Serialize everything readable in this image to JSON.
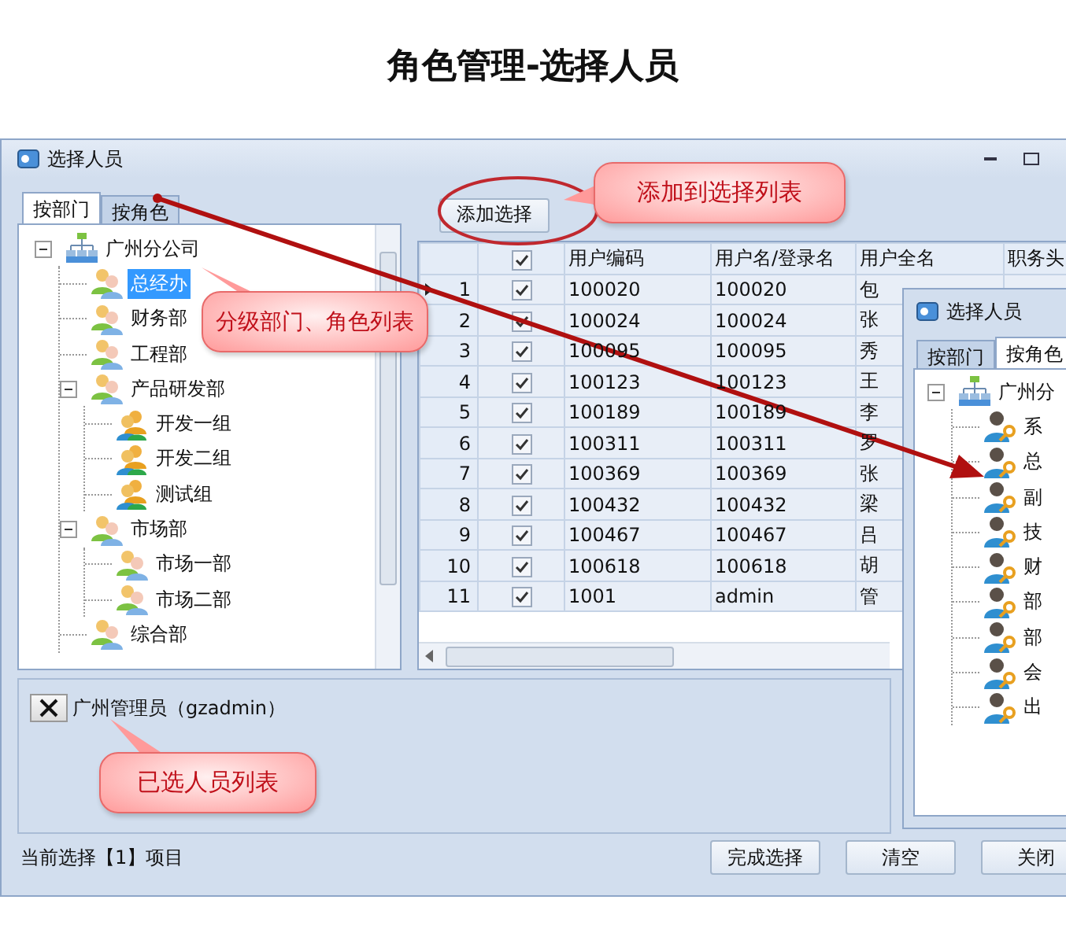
{
  "page_title": "角色管理-选择人员",
  "window": {
    "title": "选择人员"
  },
  "left_tabs": [
    {
      "label": "按部门",
      "selected": true
    },
    {
      "label": "按角色",
      "selected": false
    }
  ],
  "tree": [
    {
      "label": "广州分公司",
      "kind": "org",
      "expanded": true,
      "selected": false,
      "children": [
        {
          "label": "总经办",
          "kind": "dept",
          "selected": true
        },
        {
          "label": "财务部",
          "kind": "dept",
          "selected": false
        },
        {
          "label": "工程部",
          "kind": "dept",
          "selected": false
        },
        {
          "label": "产品研发部",
          "kind": "dept",
          "expanded": true,
          "selected": false,
          "children": [
            {
              "label": "开发一组",
              "kind": "team",
              "selected": false
            },
            {
              "label": "开发二组",
              "kind": "team",
              "selected": false
            },
            {
              "label": "测试组",
              "kind": "team",
              "selected": false
            }
          ]
        },
        {
          "label": "市场部",
          "kind": "dept",
          "expanded": true,
          "selected": false,
          "children": [
            {
              "label": "市场一部",
              "kind": "dept",
              "selected": false
            },
            {
              "label": "市场二部",
              "kind": "dept",
              "selected": false
            }
          ]
        },
        {
          "label": "综合部",
          "kind": "dept",
          "selected": false
        }
      ]
    }
  ],
  "add_button": "添加选择",
  "grid": {
    "columns": [
      "用户编码",
      "用户名/登录名",
      "用户全名",
      "职务头"
    ],
    "header_checked": true,
    "rows": [
      {
        "index": "1",
        "checked": true,
        "current": true,
        "code": "100020",
        "login": "100020",
        "full_name": "包"
      },
      {
        "index": "2",
        "checked": true,
        "current": false,
        "code": "100024",
        "login": "100024",
        "full_name": "张"
      },
      {
        "index": "3",
        "checked": true,
        "current": false,
        "code": "100095",
        "login": "100095",
        "full_name": "秀"
      },
      {
        "index": "4",
        "checked": true,
        "current": false,
        "code": "100123",
        "login": "100123",
        "full_name": "王"
      },
      {
        "index": "5",
        "checked": true,
        "current": false,
        "code": "100189",
        "login": "100189",
        "full_name": "李"
      },
      {
        "index": "6",
        "checked": true,
        "current": false,
        "code": "100311",
        "login": "100311",
        "full_name": "罗"
      },
      {
        "index": "7",
        "checked": true,
        "current": false,
        "code": "100369",
        "login": "100369",
        "full_name": "张"
      },
      {
        "index": "8",
        "checked": true,
        "current": false,
        "code": "100432",
        "login": "100432",
        "full_name": "梁"
      },
      {
        "index": "9",
        "checked": true,
        "current": false,
        "code": "100467",
        "login": "100467",
        "full_name": "吕"
      },
      {
        "index": "10",
        "checked": true,
        "current": false,
        "code": "100618",
        "login": "100618",
        "full_name": "胡"
      },
      {
        "index": "11",
        "checked": true,
        "current": false,
        "code": "1001",
        "login": "admin",
        "full_name": "管"
      }
    ]
  },
  "selected_people": [
    {
      "label": "广州管理员（gzadmin）"
    }
  ],
  "status": "当前选择【1】项目",
  "buttons": [
    "完成选择",
    "清空",
    "关闭"
  ],
  "inset_window": {
    "title": "选择人员",
    "tabs": [
      {
        "label": "按部门",
        "selected": false
      },
      {
        "label": "按角色",
        "selected": true
      }
    ],
    "tree": [
      {
        "label": "广州分",
        "kind": "org",
        "expanded": true,
        "selected": false,
        "children": [
          {
            "label": "系",
            "kind": "role",
            "selected": false
          },
          {
            "label": "总",
            "kind": "role",
            "selected": false
          },
          {
            "label": "副",
            "kind": "role",
            "selected": false
          },
          {
            "label": "技",
            "kind": "role",
            "selected": false
          },
          {
            "label": "财",
            "kind": "role",
            "selected": false
          },
          {
            "label": "部",
            "kind": "role",
            "selected": false
          },
          {
            "label": "部",
            "kind": "role",
            "selected": false
          },
          {
            "label": "会",
            "kind": "role",
            "selected": false
          },
          {
            "label": "出",
            "kind": "role",
            "selected": false
          }
        ]
      }
    ]
  },
  "callouts": [
    {
      "text": "分级部门、角色列表"
    },
    {
      "text": "添加到选择列表"
    },
    {
      "text": "已选人员列表"
    }
  ]
}
